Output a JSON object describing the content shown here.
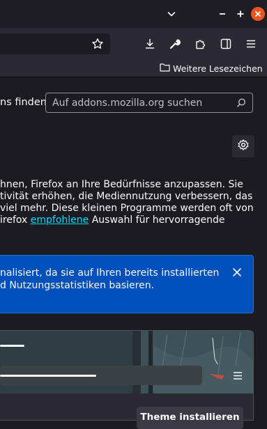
{
  "bookmarks": {
    "folder_label": "Weitere Lesezeichen",
    "folder_icon": "folder-icon"
  },
  "search": {
    "label_fragment": "ns finden",
    "placeholder": "Auf addons.mozilla.org suchen"
  },
  "intro": {
    "line1": "hnen, Firefox an Ihre Bedürfnisse anzupassen. Sie",
    "line2": "tivität erhöhen, die Mediennutzung verbessern, das",
    "line3": "viel mehr. Diese kleinen Programme werden oft von",
    "line4_before": "irefox ",
    "line4_link": "empfohlene",
    "line4_after": " Auswahl für hervorragende"
  },
  "notice": {
    "line1": "nalisiert, da sie auf Ihren bereits installierten",
    "line2": "d Nutzungsstatistiken basieren."
  },
  "theme": {
    "install_label": "Theme installieren"
  },
  "colors": {
    "background": "#1c1b22",
    "toolbar": "#2b2a33",
    "link": "#00ddff",
    "notice": "#0250bb",
    "close_button": "#e95420"
  }
}
